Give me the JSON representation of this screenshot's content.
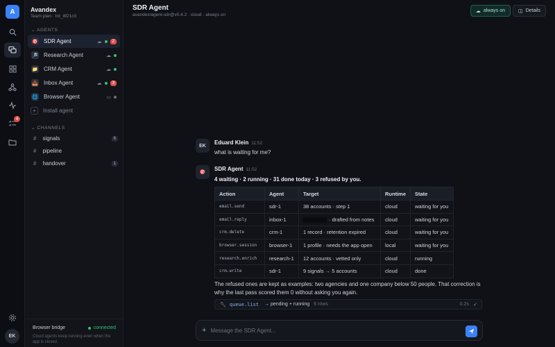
{
  "rail": {
    "logo": "A",
    "approvals_badge": "4",
    "avatar": "EK"
  },
  "workspace": {
    "name": "Avandex",
    "plan": "Team plan · tnt_8f21c0"
  },
  "sidebar": {
    "agents_header": "AGENTS",
    "agents": [
      {
        "label": "SDR Agent",
        "icon": "🎯",
        "count": "2",
        "status": "green"
      },
      {
        "label": "Research Agent",
        "icon": "🔎",
        "count": "",
        "status": "green"
      },
      {
        "label": "CRM Agent",
        "icon": "📁",
        "count": "",
        "status": "green"
      },
      {
        "label": "Inbox Agent",
        "icon": "📥",
        "count": "3",
        "status": "green"
      },
      {
        "label": "Browser Agent",
        "icon": "🌐",
        "count": "",
        "status": "grey"
      }
    ],
    "install_label": "Install agent",
    "channels_header": "CHANNELS",
    "channels": [
      {
        "label": "signals",
        "count": "6"
      },
      {
        "label": "pipeline",
        "count": ""
      },
      {
        "label": "handover",
        "count": "1"
      }
    ],
    "bridge": {
      "title": "Browser bridge",
      "status": "connected",
      "desc": "Cloud agents keep running even when the app is closed."
    }
  },
  "header": {
    "title": "SDR Agent",
    "subtitle": "avandex/agent-sdr@v0.4.2 · cloud · always on",
    "always_on": "always on",
    "details": "Details"
  },
  "messages": {
    "user": {
      "initials": "EK",
      "name": "Eduard Klein",
      "time": "11:52",
      "text": "what is waiting for me?"
    },
    "agent": {
      "name": "SDR Agent",
      "time": "11:52",
      "summary": "4 waiting · 2 running · 31 done today · 3 refused by you.",
      "paragraph": "The refused ones are kept as examples: two agencies and one company below 50 people. That correction is why the last pass scored them 0 without asking you again."
    }
  },
  "queue": {
    "headers": [
      "Action",
      "Agent",
      "Target",
      "Runtime",
      "State"
    ],
    "rows": [
      [
        "email.send",
        "sdr-1",
        "38 accounts · step 1",
        "cloud",
        "waiting for you"
      ],
      [
        "email.reply",
        "inbox-1",
        "· drafted from notes",
        "cloud",
        "waiting for you"
      ],
      [
        "crm.delete",
        "crm-1",
        "1 record · retention expired",
        "cloud",
        "waiting for you"
      ],
      [
        "browser.session",
        "browser-1",
        "1 profile · needs the app open",
        "local",
        "waiting for you"
      ],
      [
        "research.enrich",
        "research-1",
        "12 accounts · vetted only",
        "cloud",
        "running"
      ],
      [
        "crm.write",
        "sdr-1",
        "9 signals → 5 accounts",
        "cloud",
        "done"
      ]
    ]
  },
  "tool_call": {
    "name": "queue.list",
    "result": "→ pending + running",
    "rows": "6 rows",
    "duration": "0.2s"
  },
  "composer": {
    "placeholder": "Message the SDR Agent..."
  }
}
